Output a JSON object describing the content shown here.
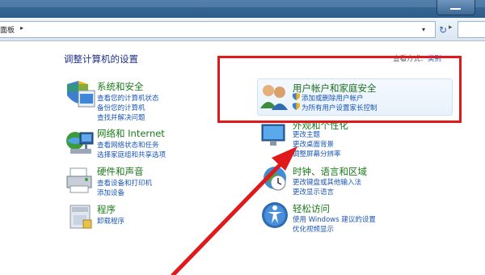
{
  "window": {
    "minimize_label": ""
  },
  "addressbar": {
    "path_tail": "面板",
    "path_arrow": "▸",
    "dropdown_arrow": "▾",
    "search_arrow": "▸",
    "refresh_symbol": "↻"
  },
  "page": {
    "title": "调整计算机的设置",
    "view_by_label": "查看方式：",
    "view_by_value": "类别"
  },
  "categories_left": [
    {
      "title": "系统和安全",
      "links": [
        "查看您的计算机状态",
        "备份您的计算机",
        "查找并解决问题"
      ],
      "icon": "shield-flag-icon"
    },
    {
      "title": "网络和 Internet",
      "links": [
        "查看网络状态和任务",
        "选择家庭组和共享选项"
      ],
      "icon": "network-globe-icon"
    },
    {
      "title": "硬件和声音",
      "links": [
        "查看设备和打印机",
        "添加设备"
      ],
      "icon": "printer-icon"
    },
    {
      "title": "程序",
      "links": [
        "卸载程序"
      ],
      "icon": "programs-box-icon"
    }
  ],
  "categories_right": [
    {
      "title": "用户帐户和家庭安全",
      "links": [
        "添加或删除用户帐户",
        "为所有用户设置家长控制"
      ],
      "icon": "users-icon"
    },
    {
      "title": "外观和个性化",
      "links": [
        "更改主题",
        "更改桌面背景",
        "调整屏幕分辨率"
      ],
      "icon": "appearance-icon"
    },
    {
      "title": "时钟、语言和区域",
      "links": [
        "更改键盘或其他输入法",
        "更改显示语言"
      ],
      "icon": "clock-globe-icon"
    },
    {
      "title": "轻松访问",
      "links": [
        "使用 Windows 建议的设置",
        "优化视频显示"
      ],
      "icon": "ease-of-access-icon"
    }
  ],
  "colors": {
    "category_title": "#1a7a1a",
    "link": "#1a56b8",
    "page_title": "#1e3287",
    "annotation": "#e0191d"
  }
}
